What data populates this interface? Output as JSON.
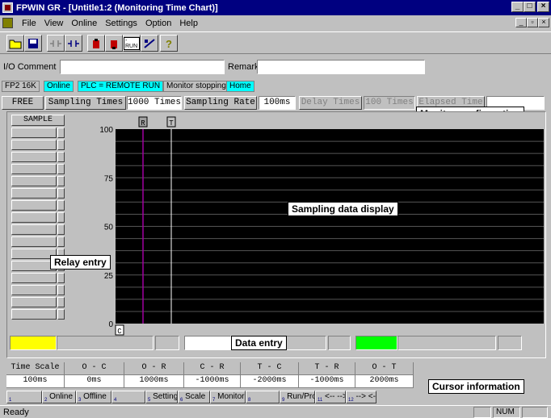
{
  "window": {
    "title": "FPWIN GR - [Untitle1:2 (Monitoring Time Chart)]"
  },
  "menu": [
    "File",
    "View",
    "Online",
    "Settings",
    "Option",
    "Help"
  ],
  "comment_bar": {
    "io_comment_label": "I/O Comment",
    "io_comment_value": "",
    "remark_label": "Remark",
    "remark_value": ""
  },
  "status_strip": {
    "plc": "FP2 16K",
    "online": "Online",
    "plc_mode": "PLC = REMOTE RUN",
    "monitor": "Monitor stopping",
    "home": "Home"
  },
  "config": {
    "mode": "FREE",
    "sampling_times_label": "Sampling Times",
    "sampling_times_value": "1000 Times",
    "sampling_rate_label": "Sampling Rate",
    "sampling_rate_value": "100ms",
    "delay_times_label": "Delay Times",
    "delay_times_value": "100 Times",
    "elapsed_time_label": "Elapsed Time",
    "elapsed_time_value": ""
  },
  "callouts": {
    "monitor_configuration": "Monitor configuration",
    "sampling_data_display": "Sampling data display",
    "relay_entry": "Relay entry",
    "data_entry": "Data entry",
    "cursor_information": "Cursor information"
  },
  "chart": {
    "sample_button": "SAMPLE",
    "y_ticks": [
      "100",
      "75",
      "50",
      "25",
      "0"
    ],
    "cursor_r": "R",
    "cursor_t": "T",
    "cursor_c": "C",
    "r_color": "#a000a0",
    "t_color": "#ffffff"
  },
  "data_entry": {
    "colors": [
      "#ffff00",
      "#ffffff",
      "#00ff00"
    ]
  },
  "cursor_info": {
    "headers": [
      "Time Scale",
      "O - C",
      "O - R",
      "C - R",
      "T - C",
      "T - R",
      "O - T"
    ],
    "values": [
      "100ms",
      "0ms",
      "1000ms",
      "-1000ms",
      "-2000ms",
      "-1000ms",
      "2000ms"
    ]
  },
  "fkeys": [
    {
      "num": "1",
      "label": ""
    },
    {
      "num": "2",
      "label": "Online"
    },
    {
      "num": "3",
      "label": "Offline"
    },
    {
      "num": "4",
      "label": ""
    },
    {
      "num": "5",
      "label": "Setting"
    },
    {
      "num": "6",
      "label": "Scale"
    },
    {
      "num": "7",
      "label": "Monitor"
    },
    {
      "num": "8",
      "label": ""
    },
    {
      "num": "9",
      "label": "Run/Pro"
    },
    {
      "num": "11",
      "label": "<-- -->"
    },
    {
      "num": "12",
      "label": "--> <--"
    }
  ],
  "statusbar": {
    "text": "Ready",
    "num": "NUM"
  }
}
